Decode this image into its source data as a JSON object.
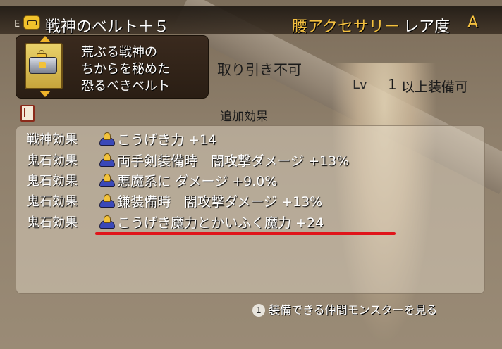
{
  "header": {
    "e_mark": "E",
    "item_name": "戦神のベルト＋５",
    "equip_slot": "腰アクセサリー",
    "rarity_label": "レア度",
    "rarity_value": "A"
  },
  "description": {
    "lines": [
      "荒ぶる戦神の",
      "ちからを秘めた",
      "恐るべきベルト"
    ]
  },
  "trade_note": "取り引き不可",
  "level": {
    "label": "Lv",
    "value": "1",
    "suffix": "以上装備可"
  },
  "effects_section": {
    "title": "追加効果",
    "rows": [
      {
        "type": "戦神効果",
        "text": "こうげき力 +14"
      },
      {
        "type": "鬼石効果",
        "text": "両手剣装備時　闇攻撃ダメージ +13%"
      },
      {
        "type": "鬼石効果",
        "text": "悪魔系に ダメージ +9.0%"
      },
      {
        "type": "鬼石効果",
        "text": "鎌装備時　闇攻撃ダメージ +13%"
      },
      {
        "type": "鬼石効果",
        "text": "こうげき魔力とかいふく魔力 +24"
      }
    ]
  },
  "footer": {
    "button": "1",
    "hint": "装備できる仲間モンスターを見る"
  },
  "colors": {
    "accent_gold": "#f4c040",
    "underline_red": "#e0141a"
  },
  "icons": {
    "title_icon": "belt-icon",
    "lock": "lock-icon",
    "book": "book-icon",
    "gem": "gem-icon"
  }
}
